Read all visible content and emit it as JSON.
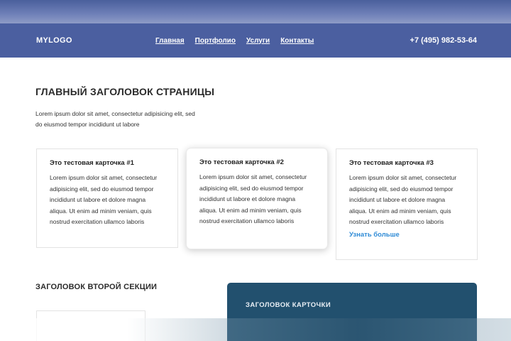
{
  "header": {
    "logo": "MYLOGO",
    "nav": [
      "Главная",
      "Портфолио",
      "Услуги",
      "Контакты"
    ],
    "phone": "+7 (495) 982-53-64"
  },
  "hero": {
    "title": "ГЛАВНЫЙ ЗАГОЛОВОК СТРАНИЦЫ",
    "lead": "Lorem ipsum dolor sit amet, consectetur adipisicing elit, sed do eiusmod tempor incididunt ut labore"
  },
  "cards": [
    {
      "title": "Это тестовая карточка #1",
      "text": "Lorem ipsum dolor sit amet, consectetur adipisicing elit, sed do eiusmod tempor incididunt ut labore et dolore magna aliqua. Ut enim ad minim veniam, quis nostrud exercitation ullamco laboris"
    },
    {
      "title": "Это тестовая карточка #2",
      "text": "Lorem ipsum dolor sit amet, consectetur adipisicing elit, sed do eiusmod tempor incididunt ut labore et dolore magna aliqua. Ut enim ad minim veniam, quis nostrud exercitation ullamco laboris"
    },
    {
      "title": "Это тестовая карточка #3",
      "text": "Lorem ipsum dolor sit amet, consectetur adipisicing elit, sed do eiusmod tempor incididunt ut labore et dolore magna aliqua. Ut enim ad minim veniam, quis nostrud exercitation ullamco laboris",
      "link": "Узнать больше"
    }
  ],
  "section2": {
    "title": "ЗАГОЛОВОК ВТОРОЙ СЕКЦИИ",
    "dark_card_title": "ЗАГОЛОВОК КАРТОЧКИ"
  },
  "colors": {
    "header_bg": "#4b5fa0",
    "link_accent": "#2f8bd6",
    "dark_card_bg": "#22506e"
  }
}
